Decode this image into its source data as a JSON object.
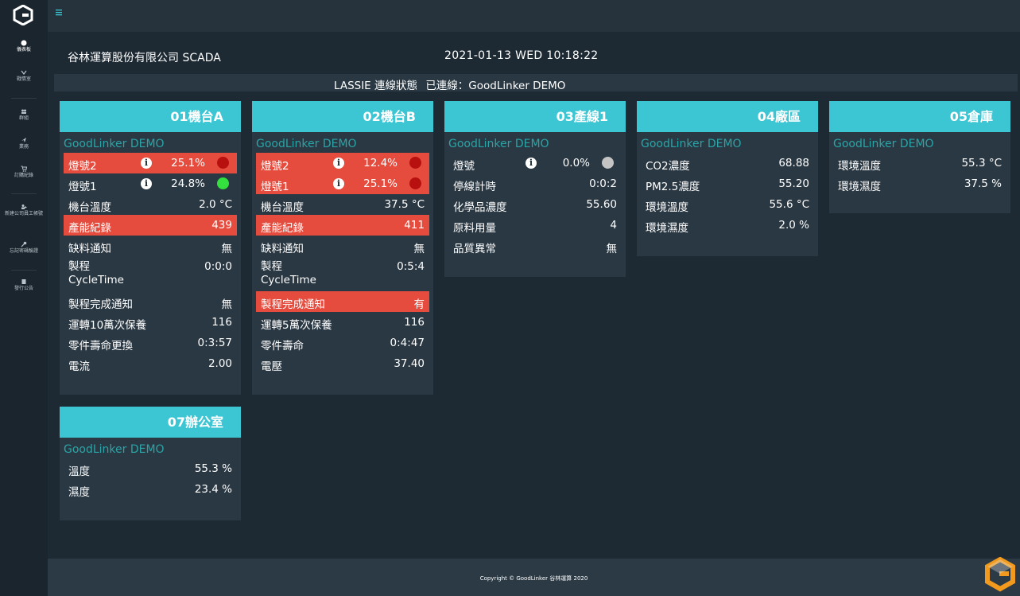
{
  "sidebar": {
    "items": [
      {
        "label": "儀表板",
        "icon": "dashboard-icon"
      },
      {
        "label": "戰情室",
        "icon": "monitor-icon"
      },
      {
        "label": "群組",
        "icon": "group-icon"
      },
      {
        "label": "業務",
        "icon": "plane-icon"
      },
      {
        "label": "訂購紀錄",
        "icon": "cart-icon"
      },
      {
        "label": "新建公司員工帳號",
        "icon": "add-user-icon"
      },
      {
        "label": "忘記密碼驗證",
        "icon": "key-icon"
      },
      {
        "label": "發行公告",
        "icon": "document-icon"
      }
    ]
  },
  "header": {
    "company": "谷林運算股份有限公司 SCADA",
    "datetime": "2021-01-13 WED 10:18:22",
    "status_label": "LASSIE 連線狀態",
    "status_value": "已連線：GoodLinker DEMO"
  },
  "cards": [
    {
      "title": "01機台A",
      "subtitle": "GoodLinker DEMO",
      "rows": [
        {
          "label": "燈號2",
          "value": "25.1%"
        },
        {
          "label": "燈號1",
          "value": "24.8%"
        },
        {
          "label": "機台溫度",
          "value": "2.0 °C"
        },
        {
          "label": "產能紀錄",
          "value": "439"
        },
        {
          "label": "缺料通知",
          "value": "無"
        },
        {
          "label": "製程",
          "label2": "CycleTime",
          "value": "0:0:0"
        },
        {
          "label": "製程完成通知",
          "value": "無"
        },
        {
          "label": "運轉10萬次保養",
          "value": "116"
        },
        {
          "label": "零件壽命更換",
          "value": "0:3:57"
        },
        {
          "label": "電流",
          "value": "2.00"
        }
      ]
    },
    {
      "title": "02機台B",
      "subtitle": "GoodLinker DEMO",
      "rows": [
        {
          "label": "燈號2",
          "value": "12.4%"
        },
        {
          "label": "燈號1",
          "value": "25.1%"
        },
        {
          "label": "機台溫度",
          "value": "37.5 °C"
        },
        {
          "label": "產能紀錄",
          "value": "411"
        },
        {
          "label": "缺料通知",
          "value": "無"
        },
        {
          "label": "製程",
          "label2": "CycleTime",
          "value": "0:5:4"
        },
        {
          "label": "製程完成通知",
          "value": "有"
        },
        {
          "label": "運轉5萬次保養",
          "value": "116"
        },
        {
          "label": "零件壽命",
          "value": "0:4:47"
        },
        {
          "label": "電壓",
          "value": "37.40"
        }
      ]
    },
    {
      "title": "03產線1",
      "subtitle": "GoodLinker DEMO",
      "rows": [
        {
          "label": "燈號",
          "value": "0.0%"
        },
        {
          "label": "停線計時",
          "value": "0:0:2"
        },
        {
          "label": "化學品濃度",
          "value": "55.60"
        },
        {
          "label": "原料用量",
          "value": "4"
        },
        {
          "label": "品質異常",
          "value": "無"
        }
      ]
    },
    {
      "title": "04廠區",
      "subtitle": "GoodLinker DEMO",
      "rows": [
        {
          "label": "CO2濃度",
          "value": "68.88"
        },
        {
          "label": "PM2.5濃度",
          "value": "55.20"
        },
        {
          "label": "環境溫度",
          "value": "55.6 °C"
        },
        {
          "label": "環境濕度",
          "value": "2.0 %"
        }
      ]
    },
    {
      "title": "05倉庫",
      "subtitle": "GoodLinker DEMO",
      "rows": [
        {
          "label": "環境溫度",
          "value": "55.3 °C"
        },
        {
          "label": "環境濕度",
          "value": "37.5 %"
        }
      ]
    },
    {
      "title": "07辦公室",
      "subtitle": "GoodLinker DEMO",
      "rows": [
        {
          "label": "溫度",
          "value": "55.3 %"
        },
        {
          "label": "濕度",
          "value": "23.4 %"
        }
      ]
    }
  ],
  "info_glyph": "i",
  "colors": {
    "accent": "#3cc5d3",
    "alarm": "#e64c3e",
    "subtitle": "#2aa4a6",
    "indicator_red": "#b80f0f",
    "indicator_green": "#33e03d",
    "indicator_off": "#c4c4c4"
  },
  "footer": {
    "copyright": "Copyright © GoodLinker 谷林運算 2020"
  }
}
